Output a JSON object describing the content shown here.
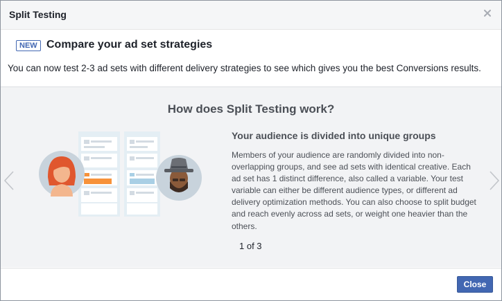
{
  "dialog": {
    "title": "Split Testing",
    "close_icon": "close-icon"
  },
  "header": {
    "badge": "NEW",
    "title": "Compare your ad set strategies",
    "text": "You can now test 2-3 ad sets with different delivery strategies to see which gives you the best Conversions results."
  },
  "content": {
    "section_title": "How does Split Testing work?",
    "desc_title": "Your audience is divided into unique groups",
    "desc_text": "Members of your audience are randomly divided into non-overlapping groups, and see ad sets with identical creative. Each ad set has 1 distinct difference, also called a variable. Your test variable can either be different audience types, or different ad delivery optimization methods. You can also choose to split budget and reach evenly across ad sets, or weight one heavier than the others.",
    "pager": "1 of 3",
    "left_arrow_icon": "chevron-left-icon",
    "right_arrow_icon": "chevron-right-icon"
  },
  "footer": {
    "close_label": "Close"
  },
  "colors": {
    "accent": "#4267b2",
    "orange": "#f7923a",
    "blue_bar": "#a9cfe5"
  }
}
